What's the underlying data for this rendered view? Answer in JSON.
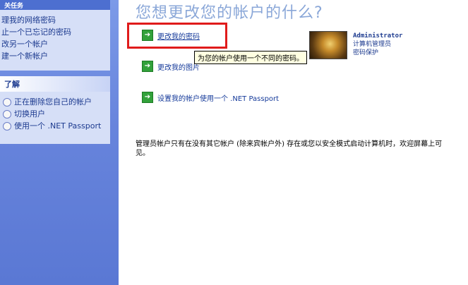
{
  "sidebar": {
    "tasks_header": "关任务",
    "tasks": [
      "理我的网络密码",
      "止一个已忘记的密码",
      "改另一个帐户",
      "建一个新帐户"
    ],
    "learn_header": "了解",
    "learn_items": [
      "正在删除您自己的帐户",
      "切换用户",
      "使用一个 .NET Passport"
    ]
  },
  "main": {
    "title": "您想更改您的帐户的什么?",
    "actions": [
      {
        "label": "更改我的密码"
      },
      {
        "label": "更改我的图片"
      },
      {
        "label": "设置我的帐户使用一个 .NET Passport"
      }
    ],
    "tooltip": "为您的帐户使用一个不同的密码。",
    "account": {
      "name": "Administrator",
      "type": "计算机管理员",
      "status": "密码保护"
    },
    "note": "管理员帐户只有在没有其它帐户 (除来宾帐户外) 存在或您以安全模式启动计算机时，欢迎屏幕上可见。"
  },
  "colors": {
    "highlight": "#e01b1b",
    "link": "#153a9a",
    "sidebar": "#6784dc"
  },
  "icons": {
    "action": "green-arrow-icon",
    "learn": "help-bullet-icon"
  }
}
